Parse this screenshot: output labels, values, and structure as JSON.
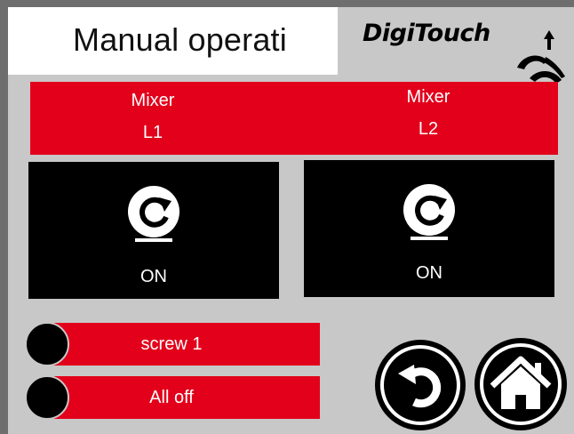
{
  "header": {
    "title": "Manual operati",
    "logo_text": "DigiTouch"
  },
  "mixers": [
    {
      "line1": "Mixer",
      "line2": "L1",
      "state": "ON",
      "icon": "rotate-icon"
    },
    {
      "line1": "Mixer",
      "line2": "L2",
      "state": "ON",
      "icon": "rotate-icon"
    }
  ],
  "controls": {
    "screw_label": "screw 1",
    "all_off_label": "All off"
  },
  "nav": {
    "back_icon": "back-arrow-icon",
    "home_icon": "home-icon"
  },
  "colors": {
    "accent_red": "#e3001b",
    "background": "#c8c8c8",
    "panel": "#000000"
  }
}
